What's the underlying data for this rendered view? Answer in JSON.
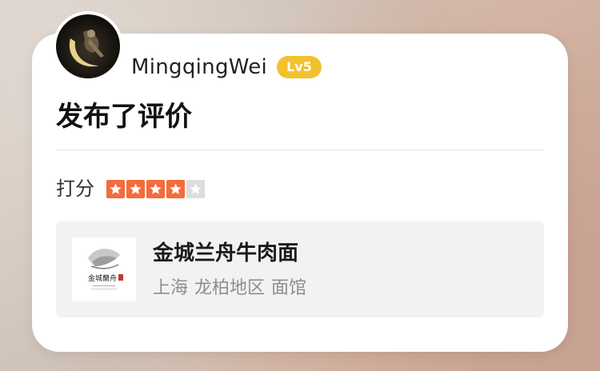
{
  "user": {
    "name": "MingqingWei",
    "level": "Lv5"
  },
  "post": {
    "action": "发布了评价"
  },
  "rating": {
    "label": "打分",
    "value": 4,
    "max": 5
  },
  "shop": {
    "name": "金城兰舟牛肉面",
    "city": "上海",
    "district": "龙柏地区",
    "category": "面馆",
    "logo_text": "金城蘭舟"
  },
  "colors": {
    "star_on": "#f26c3c",
    "star_off": "#dddddd",
    "level_badge": "#f3c12d"
  }
}
